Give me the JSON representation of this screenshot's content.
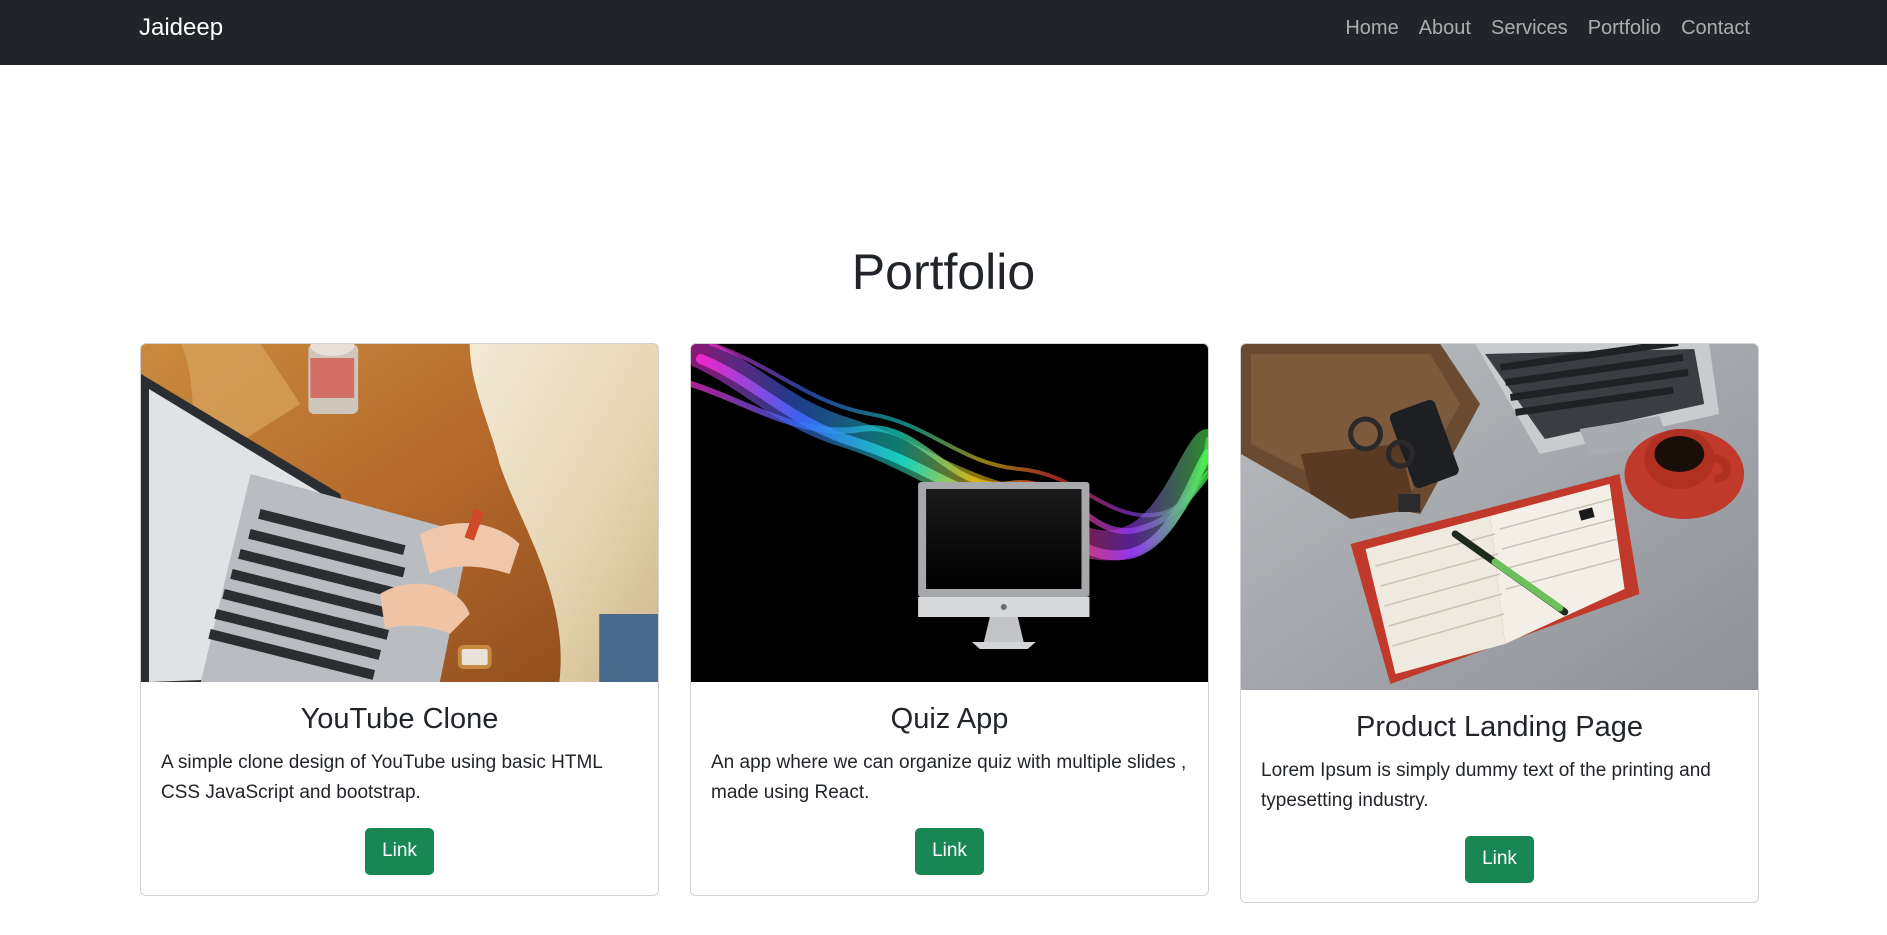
{
  "navbar": {
    "brand": "Jaideep",
    "links": [
      "Home",
      "About",
      "Services",
      "Portfolio",
      "Contact"
    ]
  },
  "portfolio": {
    "title": "Portfolio",
    "cards": [
      {
        "image": "woman-typing-on-laptop-photo",
        "title": "YouTube Clone",
        "text": "A simple clone design of YouTube using basic HTML CSS JavaScript and bootstrap.",
        "button": "Link"
      },
      {
        "image": "rainbow-smoke-monitor-photo",
        "title": "Quiz App",
        "text": "An app where we can organize quiz with multiple slides , made using React.",
        "button": "Link"
      },
      {
        "image": "desk-with-notebook-laptop-coffee-photo",
        "title": "Product Landing Page",
        "text": "Lorem Ipsum is simply dummy text of the printing and typesetting industry.",
        "button": "Link"
      }
    ]
  },
  "colors": {
    "navbar_bg": "#212529",
    "button_bg": "#198754",
    "text": "#212529"
  }
}
